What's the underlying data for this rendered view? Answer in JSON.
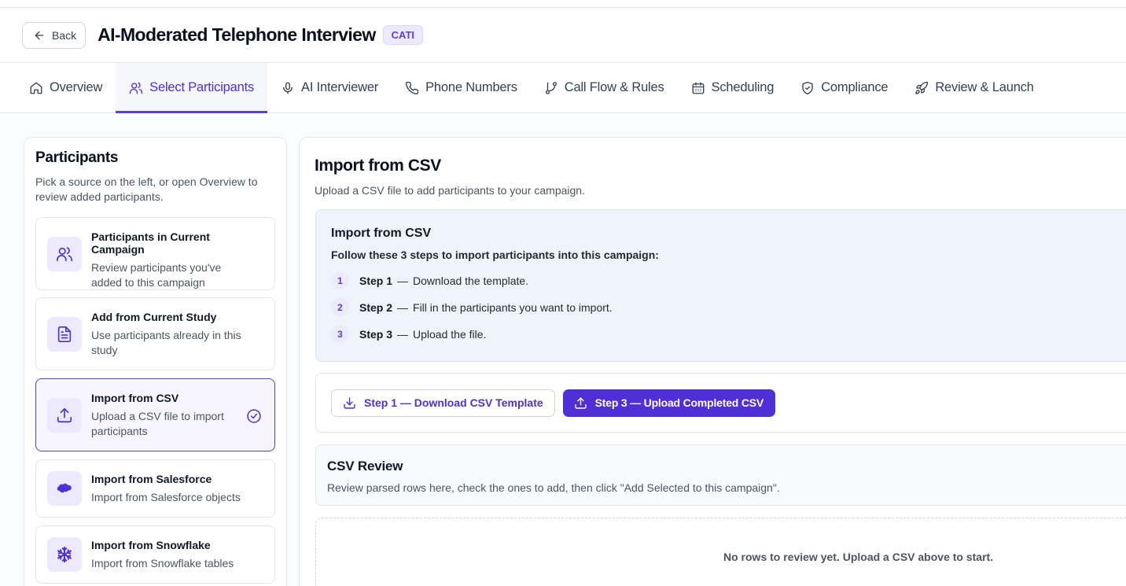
{
  "header": {
    "back_label": "Back",
    "title": "AI-Moderated Telephone Interview",
    "badge": "CATI"
  },
  "tabs": [
    {
      "label": "Overview",
      "icon": "home-icon"
    },
    {
      "label": "Select Participants",
      "icon": "users-icon",
      "active": true
    },
    {
      "label": "AI Interviewer",
      "icon": "microphone-icon"
    },
    {
      "label": "Phone Numbers",
      "icon": "phone-icon"
    },
    {
      "label": "Call Flow & Rules",
      "icon": "git-branch-icon"
    },
    {
      "label": "Scheduling",
      "icon": "calendar-icon"
    },
    {
      "label": "Compliance",
      "icon": "shield-check-icon"
    },
    {
      "label": "Review & Launch",
      "icon": "rocket-icon"
    }
  ],
  "participants_panel": {
    "title": "Participants",
    "subtitle": "Pick a source on the left, or open Overview to review added participants.",
    "sources": [
      {
        "title": "Participants in Current Campaign",
        "desc": "Review participants you've added to this campaign",
        "icon": "users-icon"
      },
      {
        "title": "Add from Current Study",
        "desc": "Use participants already in this study",
        "icon": "document-icon"
      },
      {
        "title": "Import from CSV",
        "desc": "Upload a CSV file to import participants",
        "icon": "upload-icon",
        "selected": true
      },
      {
        "title": "Import from Salesforce",
        "desc": "Import from Salesforce objects",
        "icon": "cloud-icon"
      },
      {
        "title": "Import from Snowflake",
        "desc": "Import from Snowflake tables",
        "icon": "snowflake-icon"
      }
    ]
  },
  "main": {
    "title": "Import from CSV",
    "subtitle": "Upload a CSV file to add participants to your campaign.",
    "info": {
      "title": "Import from CSV",
      "lead": "Follow these 3 steps to import participants into this campaign:",
      "steps": [
        {
          "num": "1",
          "label": "Step 1",
          "text": "Download the template."
        },
        {
          "num": "2",
          "label": "Step 2",
          "text": "Fill in the participants you want to import."
        },
        {
          "num": "3",
          "label": "Step 3",
          "text": "Upload the file."
        }
      ]
    },
    "actions": {
      "download_label": "Step 1 — Download CSV Template",
      "upload_label": "Step 3 — Upload Completed CSV"
    },
    "review": {
      "title": "CSV Review",
      "subtitle": "Review parsed rows here, check the ones to add, then click \"Add Selected to this campaign\"."
    },
    "empty_text": "No rows to review yet. Upload a CSV above to start."
  },
  "colors": {
    "accent": "#4f2fd6",
    "accent_soft": "#ede9fe",
    "info_bg": "#eef3fc"
  }
}
